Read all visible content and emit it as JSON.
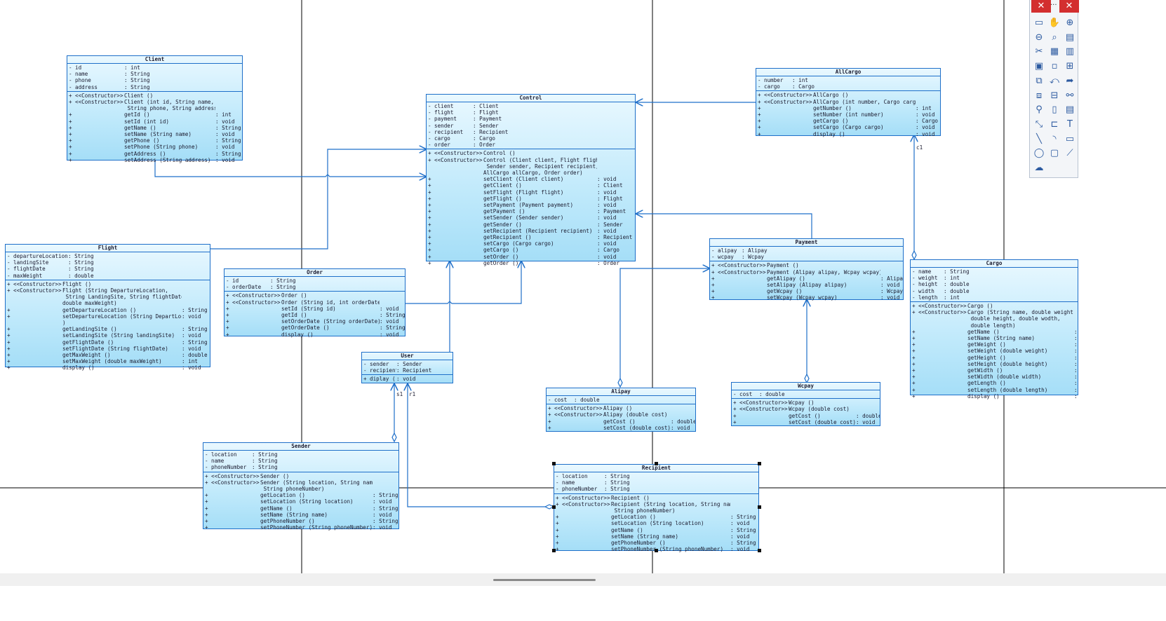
{
  "diagram": {
    "classes": [
      {
        "id": "client",
        "title": "Client",
        "an": 70,
        "ok": 70,
        "on": 130,
        "attrs": [
          [
            "-",
            "id",
            ": int"
          ],
          [
            "-",
            "name",
            ": String"
          ],
          [
            "-",
            "phone",
            ": String"
          ],
          [
            "-",
            "address",
            ": String"
          ]
        ],
        "ops": [
          [
            "+",
            "<<Constructor>>",
            "Client ()",
            ""
          ],
          [
            "+",
            "<<Constructor>>",
            "Client (int id, String name,\n String phone, String address)",
            ""
          ],
          [
            "+",
            "",
            "getId ()",
            ": int"
          ],
          [
            "+",
            "",
            "setId (int id)",
            ": void"
          ],
          [
            "+",
            "",
            "getName ()",
            ": String"
          ],
          [
            "+",
            "",
            "setName (String name)",
            ": void"
          ],
          [
            "+",
            "",
            "getPhone ()",
            ": String"
          ],
          [
            "+",
            "",
            "setPhone (String phone)",
            ": void"
          ],
          [
            "+",
            "",
            "getAddress ()",
            ": String"
          ],
          [
            "+",
            "",
            "setAddress (String address)",
            ": void"
          ]
        ]
      },
      {
        "id": "control",
        "title": "Control",
        "an": 55,
        "ok": 70,
        "on": 162,
        "attrs": [
          [
            "-",
            "client",
            ": Client"
          ],
          [
            "-",
            "flight",
            ": Flight"
          ],
          [
            "-",
            "payment",
            ": Payment"
          ],
          [
            "-",
            "sender",
            ": Sender"
          ],
          [
            "-",
            "recipient",
            ": Recipient"
          ],
          [
            "-",
            "cargo",
            ": Cargo"
          ],
          [
            "-",
            "order",
            ": Order"
          ]
        ],
        "ops": [
          [
            "+",
            "<<Constructor>>",
            "Control ()",
            ""
          ],
          [
            "+",
            "<<Constructor>>",
            "Control (Client client, Flight flight,\n Sender sender, Recipient recipient,\nAllCargo allCargo, Order order)",
            ""
          ],
          [
            "+",
            "",
            "setClient (Client client)",
            ": void"
          ],
          [
            "+",
            "",
            "getClient ()",
            ": Client"
          ],
          [
            "+",
            "",
            "setFlight (Flight flight)",
            ": void"
          ],
          [
            "+",
            "",
            "getFlight ()",
            ": Flight"
          ],
          [
            "+",
            "",
            "setPayment (Payment payment)",
            ": void"
          ],
          [
            "+",
            "",
            "getPayment ()",
            ": Payment"
          ],
          [
            "+",
            "",
            "setSender (Sender sender)",
            ": void"
          ],
          [
            "+",
            "",
            "getSender ()",
            ": Sender"
          ],
          [
            "+",
            "",
            "setRecipient (Recipient recipient)",
            ": void"
          ],
          [
            "+",
            "",
            "getRecipient ()",
            ": Recipient"
          ],
          [
            "+",
            "",
            "setCargo (Cargo cargo)",
            ": void"
          ],
          [
            "+",
            "",
            "getCargo ()",
            ": Cargo"
          ],
          [
            "+",
            "",
            "setOrder ()",
            ": void"
          ],
          [
            "+",
            "",
            "getOrder ()",
            ": Order"
          ]
        ]
      },
      {
        "id": "allcargo",
        "title": "AllCargo",
        "an": 40,
        "ok": 70,
        "on": 146,
        "attrs": [
          [
            "-",
            "number",
            ": int"
          ],
          [
            "-",
            "cargo",
            ": Cargo"
          ]
        ],
        "ops": [
          [
            "+",
            "<<Constructor>>",
            "AllCargo ()",
            ""
          ],
          [
            "+",
            "<<Constructor>>",
            "AllCargo (int number, Cargo cargo)",
            ""
          ],
          [
            "+",
            "",
            "getNumber ()",
            ": int"
          ],
          [
            "+",
            "",
            "setNumber (int number)",
            ": void"
          ],
          [
            "+",
            "",
            "getCargo ()",
            ": Cargo"
          ],
          [
            "+",
            "",
            "setCargo (Cargo cargo)",
            ": void"
          ],
          [
            "+",
            "",
            "display ()",
            ": void"
          ]
        ]
      },
      {
        "id": "flight",
        "title": "Flight",
        "an": 78,
        "ok": 70,
        "on": 170,
        "attrs": [
          [
            "-",
            "departureLocation",
            ": String"
          ],
          [
            "-",
            "landingSite",
            ": String"
          ],
          [
            "-",
            "flightDate",
            ": String"
          ],
          [
            "-",
            "maxWeight",
            ": double"
          ]
        ],
        "ops": [
          [
            "+",
            "<<Constructor>>",
            "Flight ()",
            ""
          ],
          [
            "+",
            "<<Constructor>>",
            "Flight (String DepartureLocation,\n String LandingSite, String flightDate,\ndouble maxWeight)",
            ""
          ],
          [
            "+",
            "",
            "getDepartureLocation ()",
            ": String"
          ],
          [
            "+",
            "",
            "setDepartureLocation (String DepartLocation\n)",
            ": void"
          ],
          [
            "+",
            "",
            "getLandingSite ()",
            ": String"
          ],
          [
            "+",
            "",
            "setLandingSite (String landingSite)",
            ": void"
          ],
          [
            "+",
            "",
            "getFlightDate ()",
            ": String"
          ],
          [
            "+",
            "",
            "setFlightDate (String flightDate)",
            ": void"
          ],
          [
            "+",
            "",
            "getMaxWeight ()",
            ": double"
          ],
          [
            "+",
            "",
            "setMaxWeight (double maxWeight)",
            ": int"
          ],
          [
            "+",
            "",
            "display ()",
            ": void"
          ]
        ]
      },
      {
        "id": "order",
        "title": "Order",
        "an": 54,
        "ok": 70,
        "on": 140,
        "attrs": [
          [
            "-",
            "id",
            ": String"
          ],
          [
            "-",
            "orderDate",
            ": String"
          ]
        ],
        "ops": [
          [
            "+",
            "<<Constructor>>",
            "Order ()",
            ""
          ],
          [
            "+",
            "<<Constructor>>",
            "Order (String id, int orderDate)",
            ""
          ],
          [
            "+",
            "",
            "setId (String id)",
            ": void"
          ],
          [
            "+",
            "",
            "getId ()",
            ": String"
          ],
          [
            "+",
            "",
            "setOrderDate (String orderDate)",
            ": void"
          ],
          [
            "+",
            "",
            "getOrderDate ()",
            ": String"
          ],
          [
            "+",
            "",
            "display ()",
            ": void"
          ]
        ]
      },
      {
        "id": "user",
        "title": "User",
        "an": 38,
        "ok": 0,
        "on": 38,
        "attrs": [
          [
            "-",
            "sender",
            ": Sender"
          ],
          [
            "-",
            "recipient",
            ": Recipient"
          ]
        ],
        "ops": [
          [
            "+",
            "",
            "diplay ()",
            ": void"
          ]
        ]
      },
      {
        "id": "payment",
        "title": "Payment",
        "an": 34,
        "ok": 70,
        "on": 162,
        "attrs": [
          [
            "-",
            "alipay",
            ": Alipay"
          ],
          [
            "-",
            "wcpay",
            ": Wcpay"
          ]
        ],
        "ops": [
          [
            "+",
            "<<Constructor>>",
            "Payment ()",
            ""
          ],
          [
            "+",
            "<<Constructor>>",
            "Payment (Alipay alipay, Wcpay wcpay)",
            ""
          ],
          [
            "+",
            "",
            "getAlipay ()",
            ": Alipay"
          ],
          [
            "+",
            "",
            "setAlipay (Alipay alipay)",
            ": void"
          ],
          [
            "+",
            "",
            "getWcpay ()",
            ": Wcpay"
          ],
          [
            "+",
            "",
            "setWcpay (Wcpay wcpay)",
            ": void"
          ]
        ]
      },
      {
        "id": "cargo",
        "title": "Cargo",
        "an": 36,
        "ok": 70,
        "on": 152,
        "attrs": [
          [
            "-",
            "name",
            ": String"
          ],
          [
            "-",
            "weight",
            ": int"
          ],
          [
            "-",
            "height",
            ": double"
          ],
          [
            "-",
            "width",
            ": double"
          ],
          [
            "-",
            "length",
            ": int"
          ]
        ],
        "ops": [
          [
            "+",
            "<<Constructor>>",
            "Cargo ()",
            ""
          ],
          [
            "+",
            "<<Constructor>>",
            "Cargo (String name, double weight,\n double height, double wodth,\n double length)",
            ""
          ],
          [
            "+",
            "",
            "getName ()",
            ": String"
          ],
          [
            "+",
            "",
            "setName (String name)",
            ": void"
          ],
          [
            "+",
            "",
            "getWeight ()",
            ": double"
          ],
          [
            "+",
            "",
            "setWeight (double weight)",
            ": void"
          ],
          [
            "+",
            "",
            "getHeight ()",
            ": double"
          ],
          [
            "+",
            "",
            "setHeight (double height)",
            ": void"
          ],
          [
            "+",
            "",
            "getWidth ()",
            ": double"
          ],
          [
            "+",
            "",
            "setWidth (double width)",
            ": void"
          ],
          [
            "+",
            "",
            "getLength ()",
            ": double"
          ],
          [
            "+",
            "",
            "setLength (double length)",
            ": void"
          ],
          [
            "+",
            "",
            "display ()",
            ": void"
          ]
        ]
      },
      {
        "id": "alipay",
        "title": "Alipay",
        "an": 28,
        "ok": 70,
        "on": 96,
        "attrs": [
          [
            "-",
            "cost",
            ": double"
          ]
        ],
        "ops": [
          [
            "+",
            "<<Constructor>>",
            "Alipay ()",
            ""
          ],
          [
            "+",
            "<<Constructor>>",
            "Alipay (double cost)",
            ""
          ],
          [
            "+",
            "",
            "getCost ()",
            ": double"
          ],
          [
            "+",
            "",
            "setCost (double cost)",
            ": void"
          ]
        ]
      },
      {
        "id": "wcpay",
        "title": "Wcpay",
        "an": 28,
        "ok": 70,
        "on": 96,
        "attrs": [
          [
            "-",
            "cost",
            ": double"
          ]
        ],
        "ops": [
          [
            "+",
            "<<Constructor>>",
            "Wcpay ()",
            ""
          ],
          [
            "+",
            "<<Constructor>>",
            "Wcpay (double cost)",
            ""
          ],
          [
            "+",
            "",
            "getCost ()",
            ": double"
          ],
          [
            "+",
            "",
            "setCost (double cost)",
            ": void"
          ]
        ]
      },
      {
        "id": "sender",
        "title": "Sender",
        "an": 58,
        "ok": 70,
        "on": 160,
        "attrs": [
          [
            "-",
            "location",
            ": String"
          ],
          [
            "-",
            "name",
            ": String"
          ],
          [
            "-",
            "phoneNumber",
            ": String"
          ]
        ],
        "ops": [
          [
            "+",
            "<<Constructor>>",
            "Sender ()",
            ""
          ],
          [
            "+",
            "<<Constructor>>",
            "Sender (String location, String name,\n String phoneNumber)",
            ""
          ],
          [
            "+",
            "",
            "getLocation ()",
            ": String"
          ],
          [
            "+",
            "",
            "setLocation (String location)",
            ": void"
          ],
          [
            "+",
            "",
            "getName ()",
            ": String"
          ],
          [
            "+",
            "",
            "setName (String name)",
            ": void"
          ],
          [
            "+",
            "",
            "getPhoneNumber ()",
            ": String"
          ],
          [
            "+",
            "",
            "setPhoneNumber (String phoneNumber)",
            ": void"
          ]
        ]
      },
      {
        "id": "recipient",
        "title": "Recipient",
        "an": 60,
        "ok": 70,
        "on": 170,
        "attrs": [
          [
            "-",
            "location",
            ": String"
          ],
          [
            "-",
            "name",
            ": String"
          ],
          [
            "-",
            "phoneNumber",
            ": String"
          ]
        ],
        "ops": [
          [
            "+",
            "<<Constructor>>",
            "Recipient ()",
            ""
          ],
          [
            "+",
            "<<Constructor>>",
            "Recipient (String location, String name,\n String phoneNumber)",
            ""
          ],
          [
            "+",
            "",
            "getLocation ()",
            ": String"
          ],
          [
            "+",
            "",
            "setLocation (String location)",
            ": void"
          ],
          [
            "+",
            "",
            "getName ()",
            ": String"
          ],
          [
            "+",
            "",
            "setName (String name)",
            ": void"
          ],
          [
            "+",
            "",
            "getPhoneNumber ()",
            ": String"
          ],
          [
            "+",
            "",
            "setPhoneNumber (String phoneNumber)",
            ": void"
          ]
        ]
      }
    ],
    "multiplicities": {
      "allcargo_cargo": "c1",
      "user_sender": "s1",
      "user_recipient": "r1"
    },
    "colors": {
      "line": "#1e6fc9",
      "box_top": "#e9f8ff",
      "box_bottom": "#a5def7",
      "page_border": "#000000"
    }
  },
  "toolbar": {
    "close_label": "✕",
    "ellipsis": "...",
    "icons": [
      "select-icon",
      "hand-icon",
      "zoom-in-icon",
      "zoom-out-icon",
      "zoom-fit-icon",
      "page-setup-icon",
      "cut-icon",
      "color-fill-icon",
      "table-icon",
      "class-icon",
      "small-box-icon",
      "tree-icon",
      "components-icon",
      "usecase-icon",
      "send-icon",
      "interfaces-icon",
      "hierarchy-icon",
      "link-icon",
      "pin-icon",
      "note-icon",
      "document-icon",
      "connector-icon",
      "package-icon",
      "text-icon",
      "line-icon",
      "arc-icon",
      "rectangle-icon",
      "ellipse-icon",
      "rounded-rect-icon",
      "polyline-icon",
      "freeform-icon"
    ]
  }
}
